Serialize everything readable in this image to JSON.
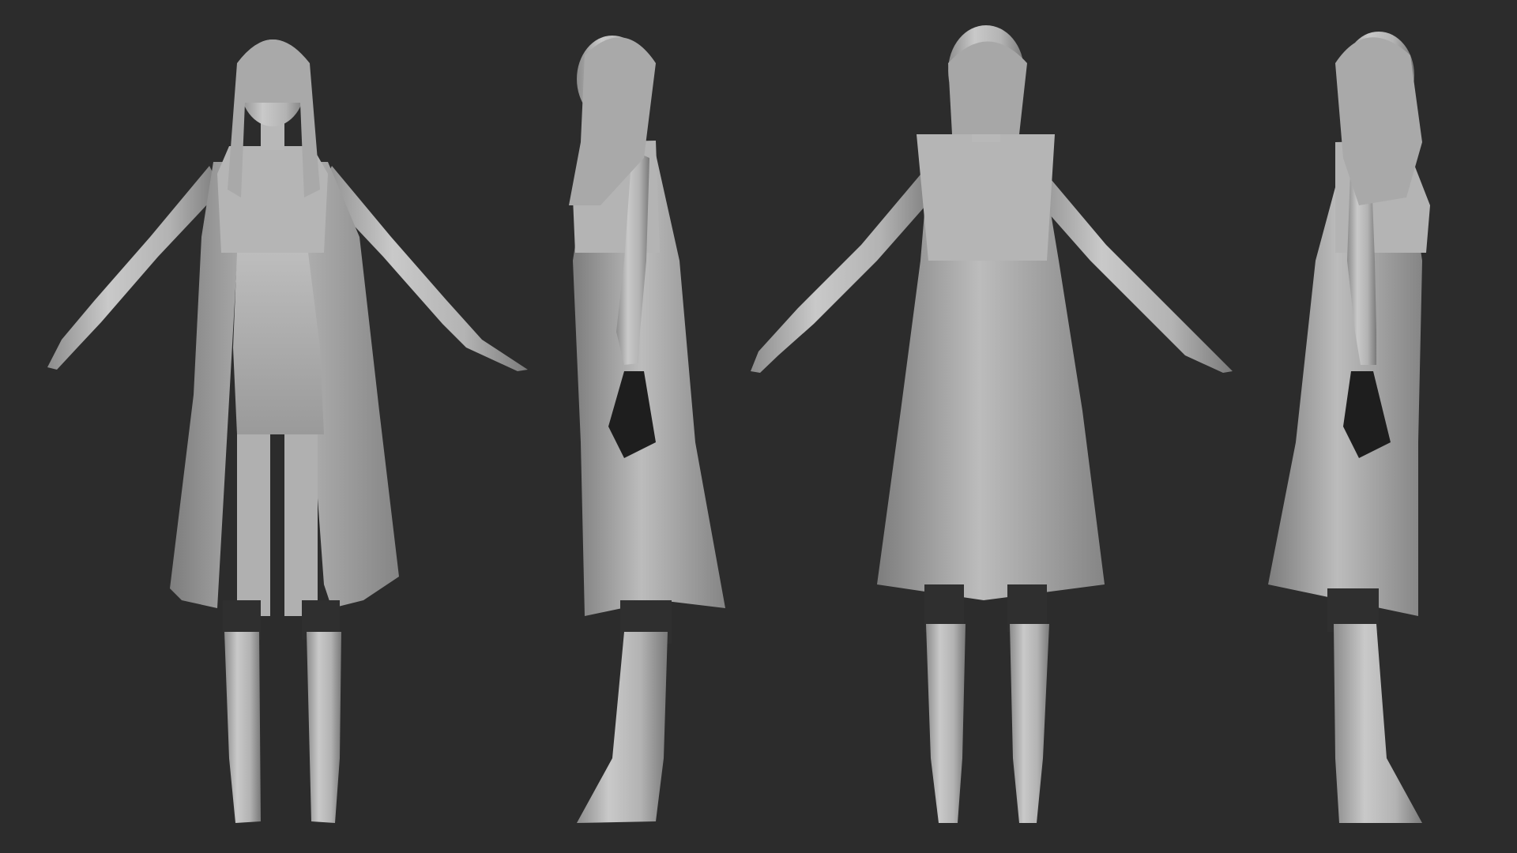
{
  "canvas": {
    "background": "#2c2c2c"
  },
  "palette": {
    "clay_light": "#c7c7c7",
    "clay_mid": "#a3a3a3",
    "clay_dark": "#6e6e6e",
    "leggings": "#2f2f2f",
    "shadow": "#1e1e1e"
  },
  "views": [
    {
      "name": "front",
      "facing": "front"
    },
    {
      "name": "side-left",
      "facing": "left"
    },
    {
      "name": "back",
      "facing": "back"
    },
    {
      "name": "side-right",
      "facing": "right"
    }
  ]
}
